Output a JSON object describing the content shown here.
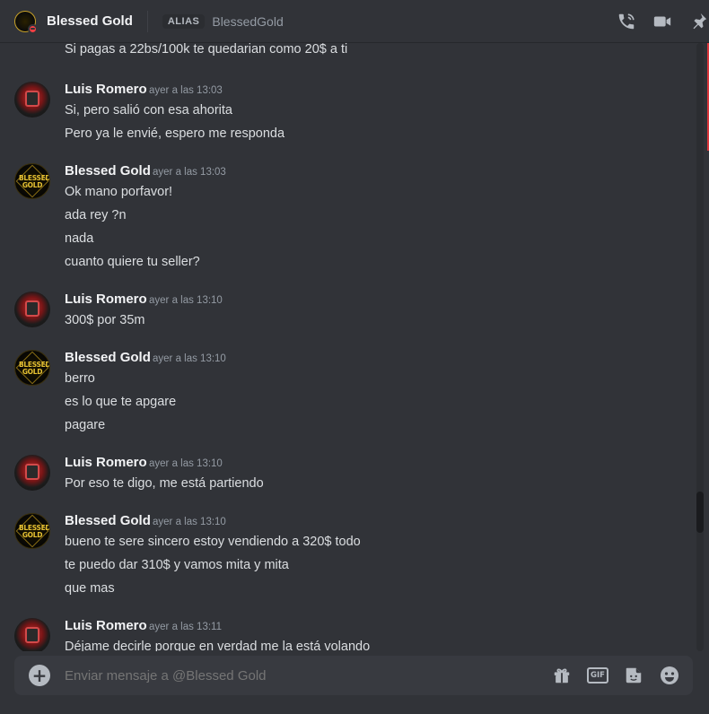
{
  "header": {
    "title": "Blessed Gold",
    "alias_badge": "ALIAS",
    "alias_value": "BlessedGold",
    "status": "dnd",
    "icons": [
      "voice-call-icon",
      "video-call-icon",
      "pin-icon"
    ]
  },
  "avatar_logo_text": "BLESSED GOLD",
  "messages": [
    {
      "continuation": true,
      "lines": [
        "Si pagas a 22bs/100k te quedarian como 20$ a ti"
      ]
    },
    {
      "author": "Luis Romero",
      "timestamp": "ayer a las 13:03",
      "lines": [
        "Si, pero salió con esa ahorita",
        "Pero ya le envié, espero me responda"
      ]
    },
    {
      "author": "Blessed Gold",
      "timestamp": "ayer a las 13:03",
      "lines": [
        "Ok mano porfavor!",
        "ada rey ?n",
        "nada",
        "cuanto quiere tu seller?"
      ]
    },
    {
      "author": "Luis Romero",
      "timestamp": "ayer a las 13:10",
      "lines": [
        "300$ por 35m"
      ]
    },
    {
      "author": "Blessed Gold",
      "timestamp": "ayer a las 13:10",
      "lines": [
        "berro",
        "es lo que te apgare",
        "pagare"
      ]
    },
    {
      "author": "Luis Romero",
      "timestamp": "ayer a las 13:10",
      "lines": [
        "Por eso te digo, me está partiendo"
      ]
    },
    {
      "author": "Blessed Gold",
      "timestamp": "ayer a las 13:10",
      "lines": [
        "bueno te sere sincero estoy vendiendo a 320$ todo",
        "te puedo dar 310$ y vamos mita y mita",
        "que mas"
      ]
    },
    {
      "author": "Luis Romero",
      "timestamp": "ayer a las 13:11",
      "lines": [
        "Déjame decirle porque en verdad me la está volando"
      ]
    }
  ],
  "composer": {
    "placeholder": "Enviar mensaje a @Blessed Gold",
    "gif_label": "GIF",
    "icons": [
      "add-attachment-icon",
      "gift-icon",
      "gif-icon",
      "sticker-icon",
      "emoji-icon"
    ]
  },
  "colors": {
    "background": "#313338",
    "composer": "#383a40",
    "dnd": "#f23f43",
    "gold": "#e7c233"
  }
}
